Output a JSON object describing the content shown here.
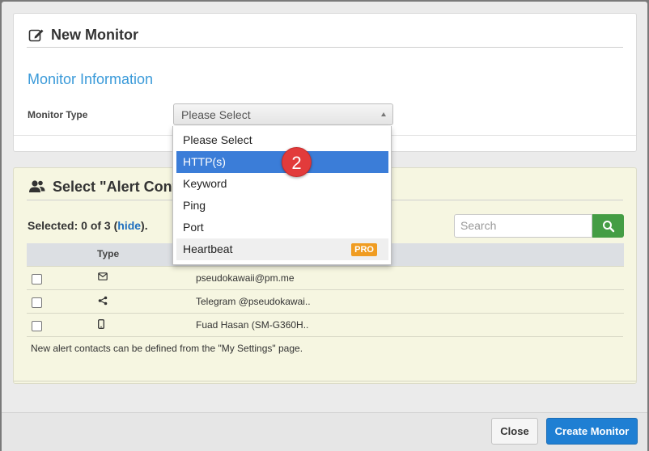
{
  "modal": {
    "title": "New Monitor",
    "section_title": "Monitor Information",
    "monitor_type_label": "Monitor Type",
    "select_value": "Please Select"
  },
  "dropdown": {
    "items": [
      {
        "label": "Please Select"
      },
      {
        "label": "HTTP(s)",
        "state": "highlighted"
      },
      {
        "label": "Keyword"
      },
      {
        "label": "Ping"
      },
      {
        "label": "Port"
      },
      {
        "label": "Heartbeat",
        "badge": "PRO"
      }
    ]
  },
  "step_marker": "2",
  "alerts": {
    "title": "Select \"Alert Cont",
    "selected_prefix": "Selected: 0 of 3 (",
    "hide_link": "hide",
    "selected_suffix": ").",
    "search_placeholder": "Search",
    "table": {
      "header_type": "Type",
      "rows": [
        {
          "icon": "envelope-icon",
          "contact": "pseudokawaii@pm.me"
        },
        {
          "icon": "share-icon",
          "contact": "Telegram @pseudokawai.."
        },
        {
          "icon": "mobile-icon",
          "contact": "Fuad Hasan (SM-G360H.."
        }
      ]
    },
    "note": "New alert contacts can be defined from the \"My Settings\" page."
  },
  "footer": {
    "close_label": "Close",
    "create_label": "Create Monitor"
  },
  "colors": {
    "accent_blue": "#3a9ad9",
    "highlight": "#3b7dd8",
    "pro_badge": "#f09c21",
    "search_button": "#449d44",
    "create_button": "#1f7fd3",
    "alert_panel": "#f6f6e1"
  }
}
